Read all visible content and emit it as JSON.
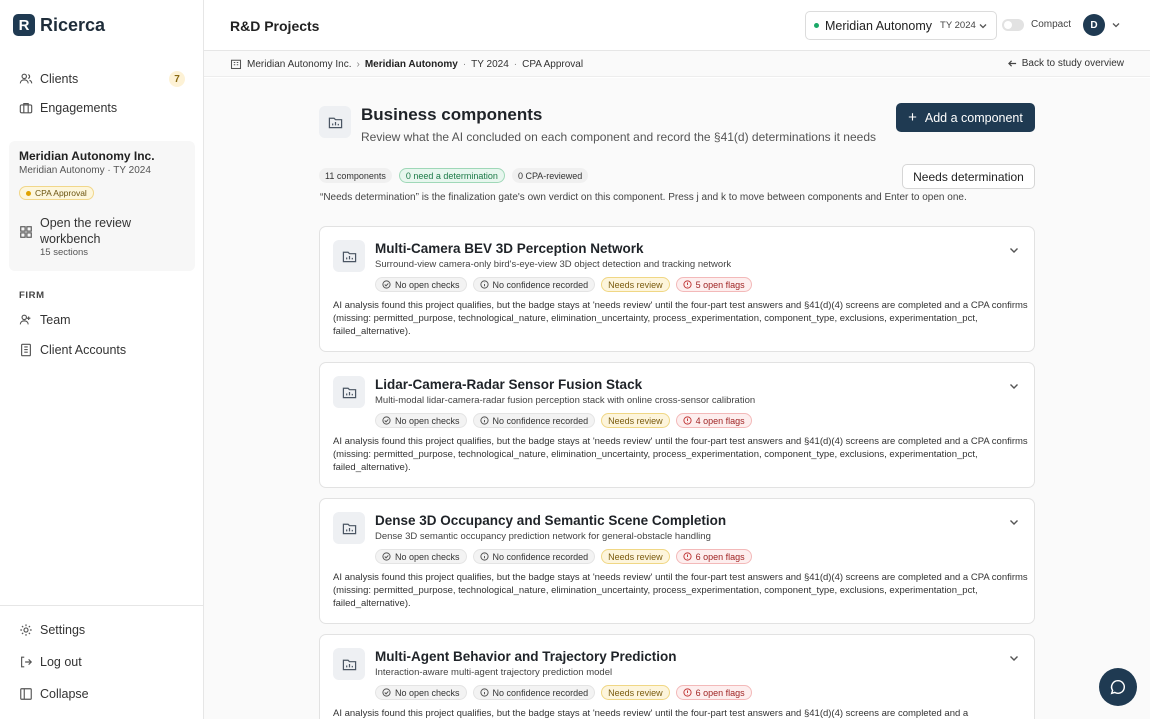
{
  "app": {
    "logo_letter": "R",
    "name": "Ricerca"
  },
  "sidebar": {
    "clients_label": "Clients",
    "clients_count": "7",
    "engagements_label": "Engagements",
    "client_name": "Meridian Autonomy Inc.",
    "client_sub": "Meridian Autonomy · TY 2024",
    "status_pill": "CPA Approval",
    "workbench_label": "Open the review workbench",
    "workbench_sub": "15 sections",
    "firm_heading": "FIRM",
    "team_label": "Team",
    "client_accounts_label": "Client Accounts",
    "settings_label": "Settings",
    "logout_label": "Log out",
    "collapse_label": "Collapse"
  },
  "header": {
    "title": "R&D Projects",
    "project_name": "Meridian Autonomy",
    "project_year": "TY 2024",
    "compact_label": "Compact",
    "avatar_initial": "D"
  },
  "breadcrumb": {
    "org": "Meridian Autonomy Inc.",
    "project": "Meridian Autonomy",
    "year": "TY 2024",
    "stage": "CPA Approval",
    "back_label": "Back to study overview"
  },
  "main": {
    "title": "Business components",
    "subtitle": "Review what the AI concluded on each component and record the §41(d) determinations it needs",
    "add_button": "Add a component",
    "filters": {
      "count": "11 components",
      "need_determination": "0 need a determination",
      "cpa_reviewed": "0 CPA-reviewed"
    },
    "needs_button": "Needs determination",
    "hint": "“Needs determination” is the finalization gate's own verdict on this component. Press j and k to move between components and Enter to open one."
  },
  "components": [
    {
      "title": "Multi-Camera BEV 3D Perception Network",
      "subtitle": "Surround-view camera-only bird's-eye-view 3D object detection and tracking network",
      "checks": "No open checks",
      "confidence": "No confidence recorded",
      "status": "Needs review",
      "flags": "5 open flags",
      "desc": "AI analysis found this project qualifies, but the badge stays at 'needs review' until the four-part test answers and §41(d)(4) screens are completed and a CPA confirms (missing: permitted_purpose, technological_nature, elimination_uncertainty, process_experimentation, component_type, exclusions, experimentation_pct, failed_alternative)."
    },
    {
      "title": "Lidar-Camera-Radar Sensor Fusion Stack",
      "subtitle": "Multi-modal lidar-camera-radar fusion perception stack with online cross-sensor calibration",
      "checks": "No open checks",
      "confidence": "No confidence recorded",
      "status": "Needs review",
      "flags": "4 open flags",
      "desc": "AI analysis found this project qualifies, but the badge stays at 'needs review' until the four-part test answers and §41(d)(4) screens are completed and a CPA confirms (missing: permitted_purpose, technological_nature, elimination_uncertainty, process_experimentation, component_type, exclusions, experimentation_pct, failed_alternative)."
    },
    {
      "title": "Dense 3D Occupancy and Semantic Scene Completion",
      "subtitle": "Dense 3D semantic occupancy prediction network for general-obstacle handling",
      "checks": "No open checks",
      "confidence": "No confidence recorded",
      "status": "Needs review",
      "flags": "6 open flags",
      "desc": "AI analysis found this project qualifies, but the badge stays at 'needs review' until the four-part test answers and §41(d)(4) screens are completed and a CPA confirms (missing: permitted_purpose, technological_nature, elimination_uncertainty, process_experimentation, component_type, exclusions, experimentation_pct, failed_alternative)."
    },
    {
      "title": "Multi-Agent Behavior and Trajectory Prediction",
      "subtitle": "Interaction-aware multi-agent trajectory prediction model",
      "checks": "No open checks",
      "confidence": "No confidence recorded",
      "status": "Needs review",
      "flags": "6 open flags",
      "desc": "AI analysis found this project qualifies, but the badge stays at 'needs review' until the four-part test answers and §41(d)(4) screens are completed and a"
    }
  ],
  "icons": {
    "clients": "users-icon",
    "engagements": "briefcase-icon",
    "workbench": "grid-icon",
    "team": "team-icon",
    "client_accounts": "building-icon",
    "settings": "gear-icon",
    "logout": "logout-icon",
    "collapse": "sidebar-icon",
    "component": "folder-chart-icon",
    "chat": "chat-icon"
  },
  "colors": {
    "brand": "#1f3a52",
    "status_amber": "#e0a200",
    "flag_red": "#d64545",
    "success_green": "#1aa867"
  }
}
